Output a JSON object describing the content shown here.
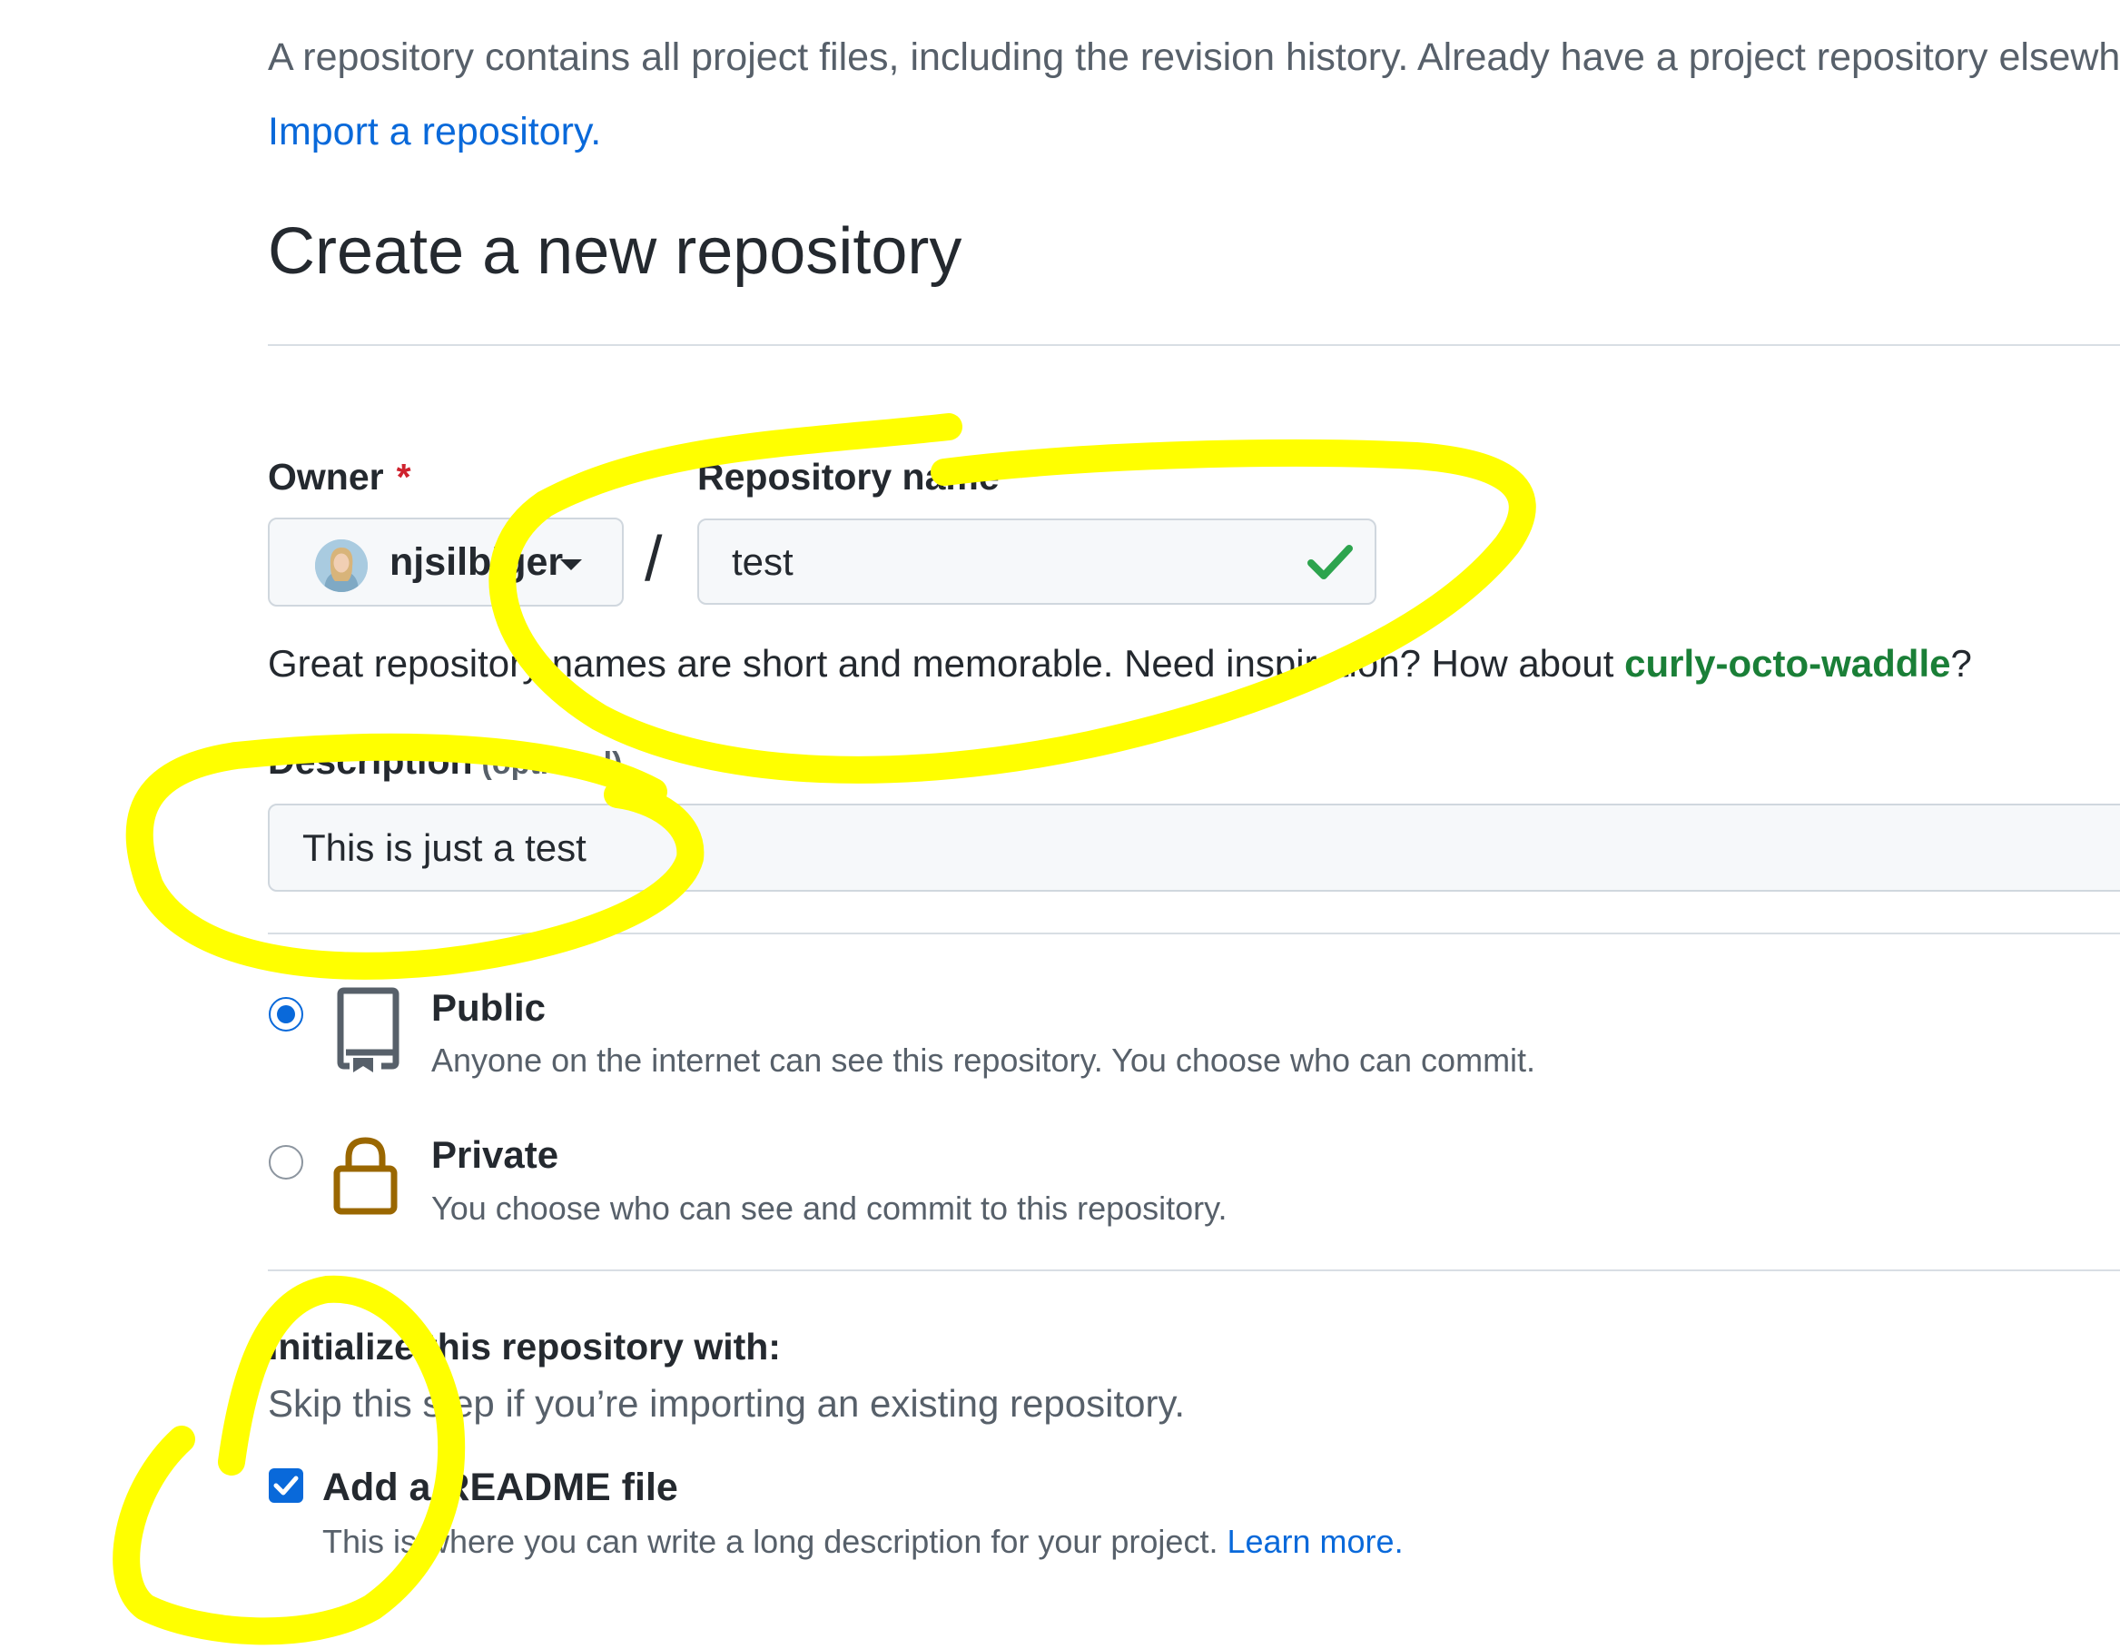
{
  "intro": {
    "text": "A repository contains all project files, including the revision history. Already have a project repository elsewhere?",
    "import_link": "Import a repository."
  },
  "page_title": "Create a new repository",
  "owner": {
    "label": "Owner",
    "required_marker": "*",
    "selected": "njsilbiger",
    "avatar_icon": "user-avatar"
  },
  "separator": "/",
  "repo_name": {
    "label": "Repository name",
    "required_marker": "*",
    "value": "test",
    "status_icon": "check-icon",
    "status_color": "#2da44e"
  },
  "name_hint": {
    "text_before": "Great repository names are short and memorable. Need inspiration? How about ",
    "suggestion": "curly-octo-waddle",
    "text_after": "?"
  },
  "description": {
    "label": "Description",
    "optional_label": "(optional)",
    "value": "This is just a test"
  },
  "visibility": {
    "selected": "public",
    "options": [
      {
        "id": "public",
        "title": "Public",
        "description": "Anyone on the internet can see this repository. You choose who can commit.",
        "icon": "repo-book-icon",
        "icon_color": "#57606a"
      },
      {
        "id": "private",
        "title": "Private",
        "description": "You choose who can see and commit to this repository.",
        "icon": "lock-icon",
        "icon_color": "#9a6700"
      }
    ]
  },
  "initialize": {
    "title": "Initialize this repository with:",
    "subtitle": "Skip this step if you’re importing an existing repository.",
    "readme": {
      "checked": true,
      "label": "Add a README file",
      "description": "This is where you can write a long description for your project.",
      "learn_more": "Learn more."
    }
  },
  "colors": {
    "accent": "#0969da",
    "link": "#0969da",
    "success": "#1a7f37",
    "required": "#cf222e",
    "annotation_highlight": "#ffff00"
  }
}
